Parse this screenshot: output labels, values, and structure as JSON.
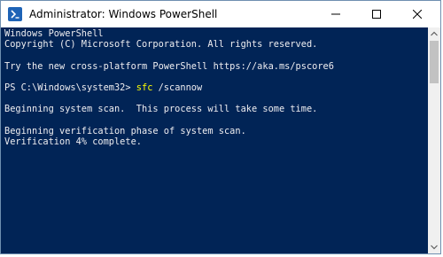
{
  "window": {
    "title": "Administrator: Windows PowerShell"
  },
  "icons": {
    "app": "powershell-icon",
    "minimize": "minimize-icon",
    "maximize": "maximize-icon",
    "close": "close-icon"
  },
  "colors": {
    "console_bg": "#012456",
    "console_text": "#EEEDF0",
    "command_color": "#FFFF00"
  },
  "console": {
    "lines": [
      "Windows PowerShell",
      "Copyright (C) Microsoft Corporation. All rights reserved.",
      "",
      "Try the new cross-platform PowerShell https://aka.ms/pscore6",
      "",
      "PS C:\\Windows\\system32> ",
      "",
      "Beginning system scan.  This process will take some time.",
      "",
      "Beginning verification phase of system scan.",
      "Verification 4% complete."
    ],
    "command": {
      "name": "sfc",
      "args": " /scannow"
    }
  }
}
